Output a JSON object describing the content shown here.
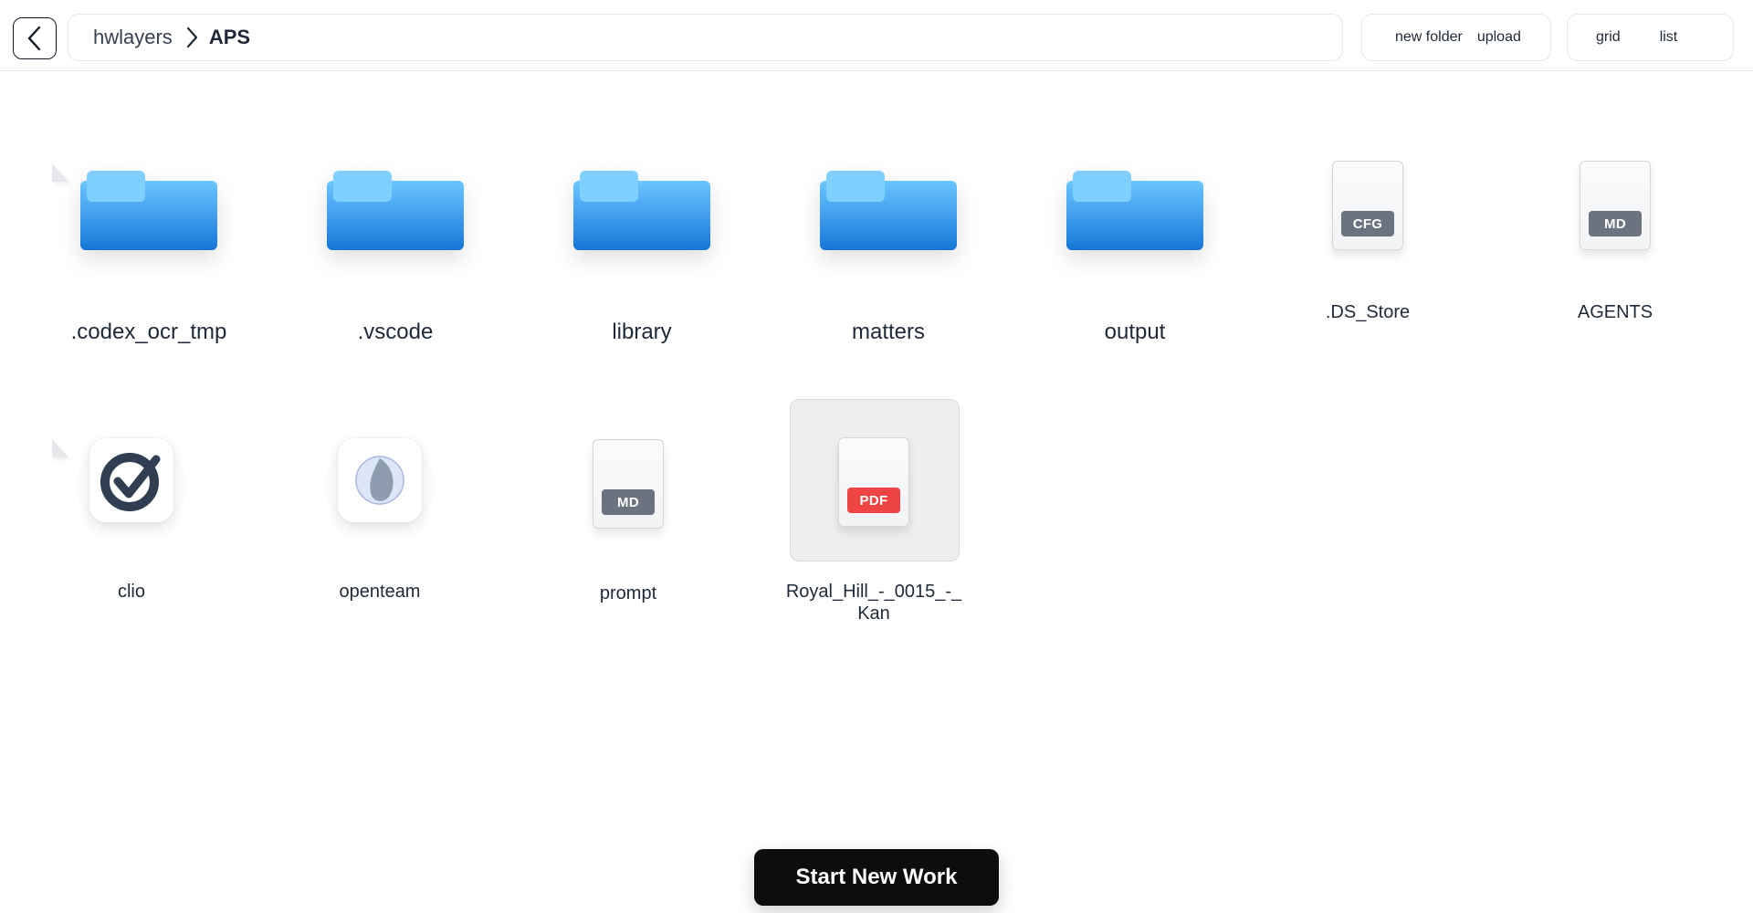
{
  "breadcrumb": [
    "hwlayers",
    "APS"
  ],
  "toolbar": {
    "new_folder": "new folder",
    "upload": "upload",
    "grid": "grid",
    "list": "list"
  },
  "colors": {
    "folder_top": "#7fd0ff",
    "folder_body": "#1a7fe0",
    "cfg_tag": "#6b7280",
    "md_tag": "#6b7280",
    "pdf_tag": "#ef4444",
    "start_button": "#0d0d0d"
  },
  "items": [
    {
      "name": ".codex_ocr_tmp",
      "kind": "folder"
    },
    {
      "name": ".vscode",
      "kind": "folder"
    },
    {
      "name": "library",
      "kind": "folder"
    },
    {
      "name": "matters",
      "kind": "folder"
    },
    {
      "name": "output",
      "kind": "folder"
    },
    {
      "name": ".DS_Store",
      "kind": "file",
      "tag": "CFG"
    },
    {
      "name": "AGENTS",
      "kind": "file",
      "tag": "MD"
    },
    {
      "name": "clio",
      "kind": "app",
      "icon": "clio-check-icon"
    },
    {
      "name": "openteam",
      "kind": "app",
      "icon": "openteam-leaf-icon"
    },
    {
      "name": "prompt",
      "kind": "file",
      "tag": "MD"
    },
    {
      "name": "Royal_Hill_-_0015_-_Kan",
      "kind": "file",
      "tag": "PDF",
      "selected": true
    }
  ],
  "start_button": "Start New Work"
}
